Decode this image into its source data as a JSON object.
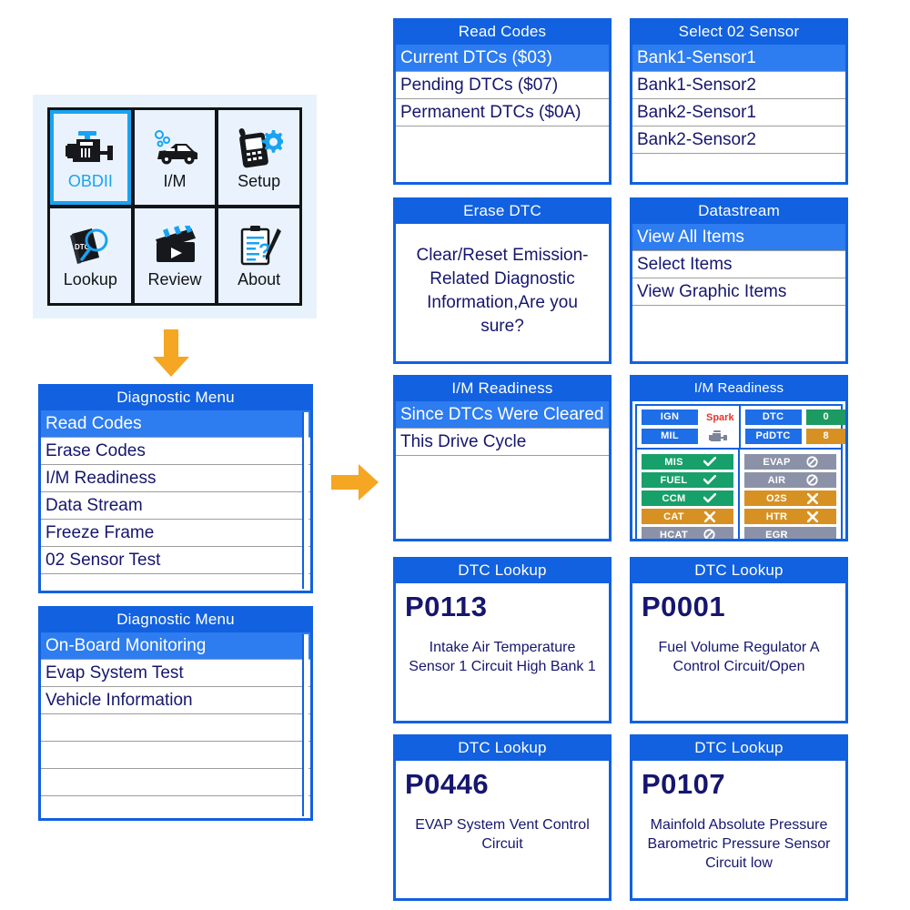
{
  "home": {
    "tiles": [
      {
        "label": "OBDII",
        "icon": "engine-icon",
        "selected": true
      },
      {
        "label": "I/M",
        "icon": "car-icon",
        "selected": false
      },
      {
        "label": "Setup",
        "icon": "scanner-gear-icon",
        "selected": false
      },
      {
        "label": "Lookup",
        "icon": "dtc-magnifier-icon",
        "selected": false
      },
      {
        "label": "Review",
        "icon": "clapperboard-icon",
        "selected": false
      },
      {
        "label": "About",
        "icon": "clipboard-question-icon",
        "selected": false
      }
    ]
  },
  "arrows": {
    "down": "arrow-down-icon",
    "right": "arrow-right-icon",
    "color": "#f5a623"
  },
  "diagnostic_menu_1": {
    "title": "Diagnostic Menu",
    "items": [
      {
        "label": "Read Codes",
        "selected": true
      },
      {
        "label": "Erase Codes",
        "selected": false
      },
      {
        "label": "I/M Readiness",
        "selected": false
      },
      {
        "label": "Data Stream",
        "selected": false
      },
      {
        "label": "Freeze Frame",
        "selected": false
      },
      {
        "label": "02 Sensor Test",
        "selected": false
      }
    ]
  },
  "diagnostic_menu_2": {
    "title": "Diagnostic Menu",
    "items": [
      {
        "label": "On-Board Monitoring",
        "selected": true
      },
      {
        "label": "Evap System Test",
        "selected": false
      },
      {
        "label": "Vehicle Information",
        "selected": false
      },
      {
        "label": "",
        "selected": false
      },
      {
        "label": "",
        "selected": false
      },
      {
        "label": "",
        "selected": false
      }
    ]
  },
  "read_codes": {
    "title": "Read Codes",
    "items": [
      {
        "label": "Current DTCs ($03)",
        "selected": true
      },
      {
        "label": "Pending DTCs ($07)",
        "selected": false
      },
      {
        "label": "Permanent DTCs ($0A)",
        "selected": false
      }
    ]
  },
  "select_o2_sensor": {
    "title": "Select 02 Sensor",
    "items": [
      {
        "label": "Bank1-Sensor1",
        "selected": true
      },
      {
        "label": "Bank1-Sensor2",
        "selected": false
      },
      {
        "label": "Bank2-Sensor1",
        "selected": false
      },
      {
        "label": "Bank2-Sensor2",
        "selected": false
      }
    ]
  },
  "erase_dtc": {
    "title": "Erase DTC",
    "message": "Clear/Reset Emission-Related Diagnostic Information,Are you sure?"
  },
  "datastream": {
    "title": "Datastream",
    "items": [
      {
        "label": "View All Items",
        "selected": true
      },
      {
        "label": "Select Items",
        "selected": false
      },
      {
        "label": "View Graphic Items",
        "selected": false
      }
    ]
  },
  "im_readiness_menu": {
    "title": "I/M Readiness",
    "items": [
      {
        "label": "Since DTCs Were Cleared",
        "selected": true
      },
      {
        "label": "This Drive Cycle",
        "selected": false
      }
    ]
  },
  "im_readiness_status": {
    "title": "I/M Readiness",
    "top_left": [
      {
        "key": "IGN",
        "value": "Spark",
        "value_type": "text"
      },
      {
        "key": "MIL",
        "value": "",
        "value_type": "engine-icon"
      }
    ],
    "top_right": [
      {
        "key": "DTC",
        "value": "0",
        "value_type": "num",
        "color": "green"
      },
      {
        "key": "PdDTC",
        "value": "8",
        "value_type": "num",
        "color": "amber"
      }
    ],
    "monitors_left": [
      {
        "label": "MIS",
        "state": "ok",
        "icon": "check-icon"
      },
      {
        "label": "FUEL",
        "state": "ok",
        "icon": "check-icon"
      },
      {
        "label": "CCM",
        "state": "ok",
        "icon": "check-icon"
      },
      {
        "label": "CAT",
        "state": "bad",
        "icon": "cross-icon"
      },
      {
        "label": "HCAT",
        "state": "na",
        "icon": "not-allowed-icon"
      }
    ],
    "monitors_right": [
      {
        "label": "EVAP",
        "state": "na",
        "icon": "not-allowed-icon"
      },
      {
        "label": "AIR",
        "state": "na",
        "icon": "not-allowed-icon"
      },
      {
        "label": "O2S",
        "state": "bad",
        "icon": "cross-icon"
      },
      {
        "label": "HTR",
        "state": "bad",
        "icon": "cross-icon"
      },
      {
        "label": "EGR",
        "state": "na",
        "icon": "none"
      }
    ],
    "colors": {
      "ok": "#18a06a",
      "bad": "#d79122",
      "na": "#8b92a8",
      "header": "#1e6ee8"
    }
  },
  "dtc_lookup_1": {
    "title": "DTC Lookup",
    "code": "P0113",
    "description": "Intake Air Temperature Sensor 1 Circuit High Bank 1"
  },
  "dtc_lookup_2": {
    "title": "DTC Lookup",
    "code": "P0001",
    "description": "Fuel Volume Regulator A Control Circuit/Open"
  },
  "dtc_lookup_3": {
    "title": "DTC Lookup",
    "code": "P0446",
    "description": "EVAP System Vent Control Circuit"
  },
  "dtc_lookup_4": {
    "title": "DTC Lookup",
    "code": "P0107",
    "description": "Mainfold Absolute Pressure Barometric Pressure Sensor Circuit low"
  }
}
